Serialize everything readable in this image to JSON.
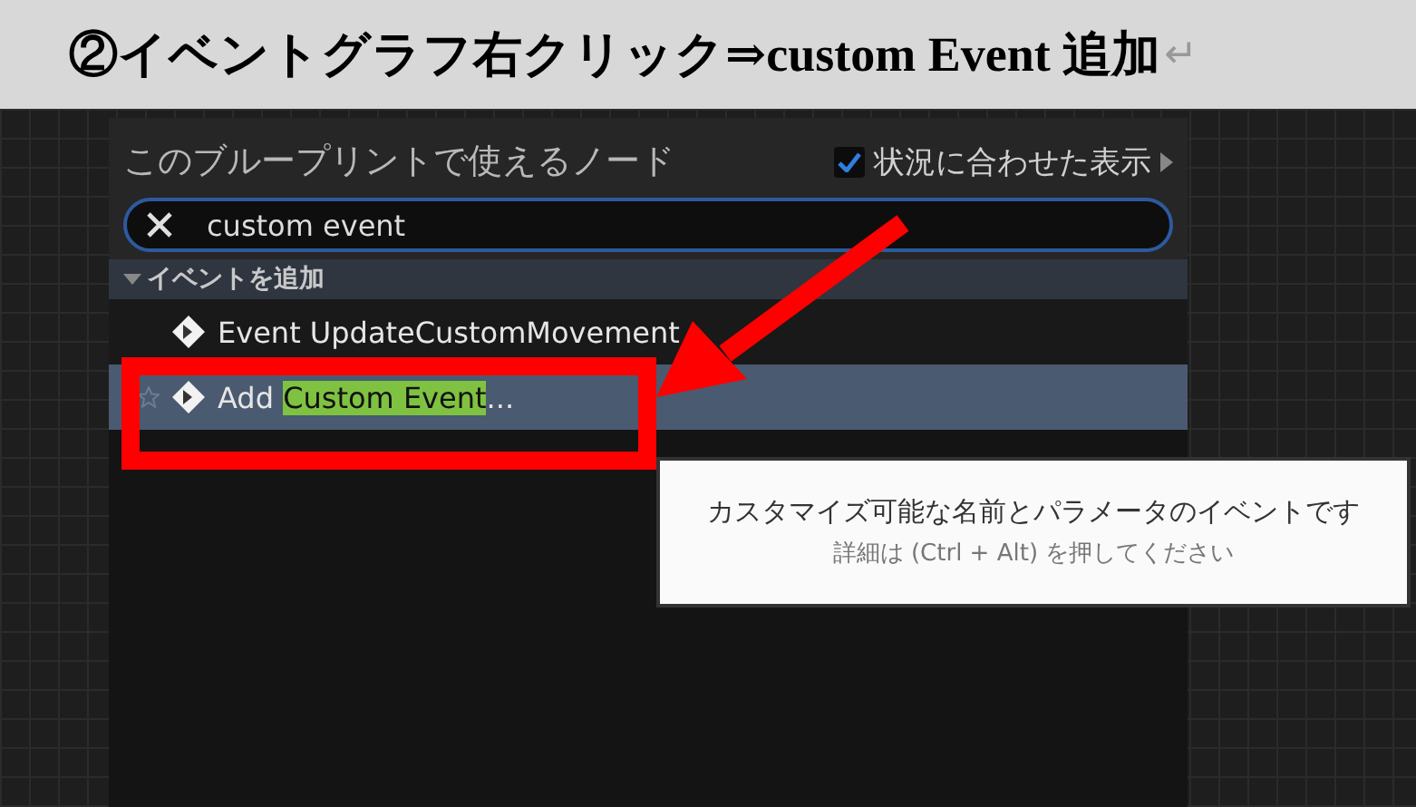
{
  "heading": {
    "text": "②イベントグラフ右クリック⇒custom Event 追加",
    "paragraph_mark": "↵"
  },
  "panel": {
    "title": "このブループリントで使えるノード",
    "context_toggle": {
      "label": "状況に合わせた表示",
      "checked": true
    },
    "search": {
      "value": "custom event"
    },
    "category": {
      "label": "イベントを追加",
      "expanded": true
    },
    "items": [
      {
        "label": "Event UpdateCustomMovement",
        "selected": false
      },
      {
        "label": "Add ",
        "match": "Custom Event",
        "suffix": "...",
        "selected": true
      }
    ]
  },
  "tooltip": {
    "text": "カスタマイズ可能な名前とパラメータのイベントです",
    "hint": "詳細は (Ctrl + Alt) を押してください"
  }
}
